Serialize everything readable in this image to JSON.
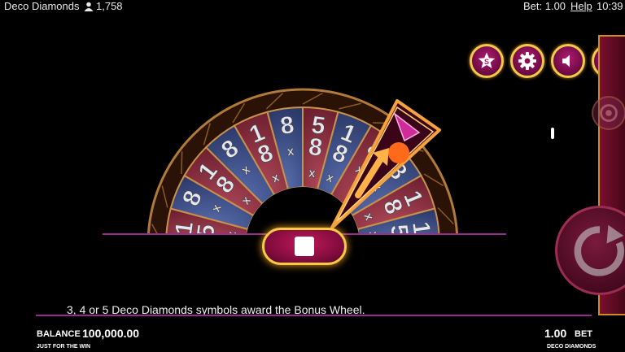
{
  "topbar": {
    "title": "Deco Diamonds",
    "player_count": "1,758",
    "bet": "Bet: 1.00",
    "help": "Help",
    "clock": "10:39"
  },
  "controls": {
    "bonus_icon": "star-s-icon",
    "settings_icon": "gear-icon",
    "sound_icon": "speaker-icon",
    "close_icon": "close-icon"
  },
  "wheel": {
    "segments": [
      {
        "value": "15",
        "color": "red"
      },
      {
        "value": "8",
        "color": "blue"
      },
      {
        "value": "18",
        "color": "red"
      },
      {
        "value": "8",
        "color": "blue"
      },
      {
        "value": "18",
        "color": "red"
      },
      {
        "value": "8",
        "color": "blue"
      },
      {
        "value": "58",
        "color": "red"
      },
      {
        "value": "18",
        "color": "blue"
      },
      {
        "value": "8",
        "color": "red"
      },
      {
        "value": "8",
        "color": "blue"
      },
      {
        "value": "18",
        "color": "red"
      },
      {
        "value": "15",
        "color": "blue"
      }
    ],
    "multiplier_sign": "x"
  },
  "info_text": "3, 4 or 5 Deco Diamonds symbols award the Bonus Wheel.",
  "footer": {
    "balance_label": "BALANCE",
    "balance_value": "100,000.00",
    "left_sub": "JUST FOR THE WIN",
    "bet_value": "1.00",
    "bet_label": "BET",
    "right_sub": "DECO DIAMONDS"
  },
  "colors": {
    "accent_magenta": "#9b2a8f",
    "gold": "#f2c94c",
    "wheel_red": "#8c3242",
    "wheel_blue": "#3c4f86"
  }
}
